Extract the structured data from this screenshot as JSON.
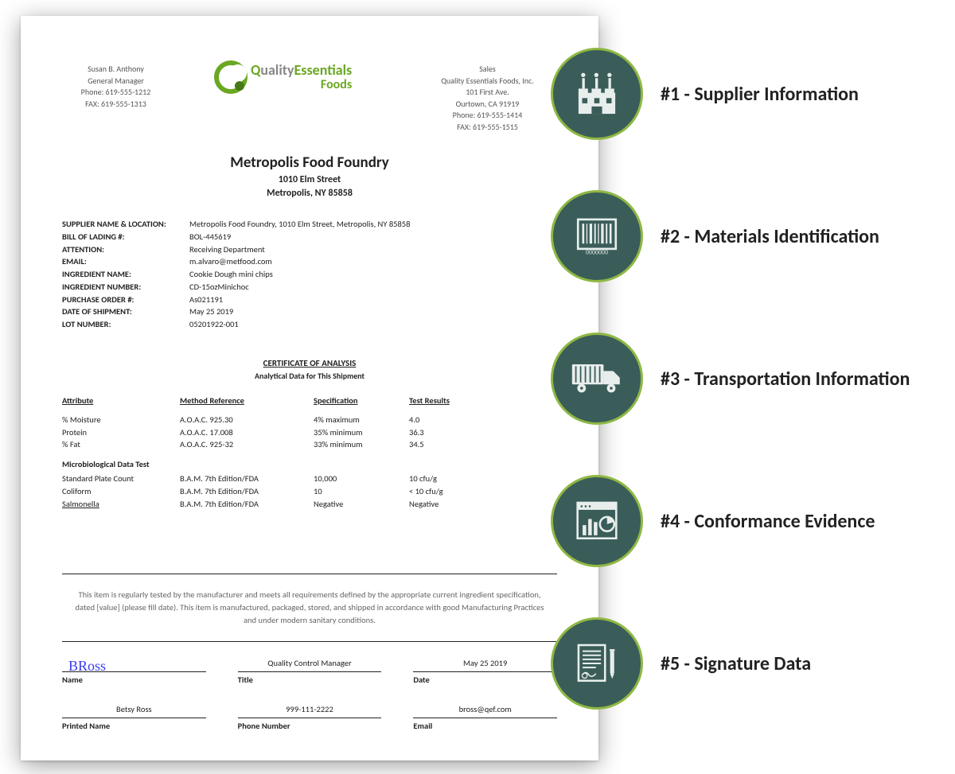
{
  "header": {
    "left": {
      "name": "Susan B. Anthony",
      "role": "General Manager",
      "phone": "Phone: 619-555-1212",
      "fax": "FAX: 619-555-1313"
    },
    "right": {
      "dept": "Sales",
      "company": "Quality Essentials Foods, Inc.",
      "addr": "101 First Ave.",
      "city": "Ourtown, CA 91919",
      "phone": "Phone: 619-555-1414",
      "fax": "FAX: 619-555-1515"
    },
    "logo": {
      "word1a": "uality",
      "word1b": "Essentials",
      "word2": "Foods"
    }
  },
  "addressee": {
    "name": "Metropolis Food Foundry",
    "line1": "1010 Elm Street",
    "line2": "Metropolis, NY 85858"
  },
  "meta": [
    {
      "k": "SUPPLIER NAME & LOCATION:",
      "v": "Metropolis Food Foundry, 1010 Elm Street, Metropolis, NY 85858"
    },
    {
      "k": "BILL OF LADING #:",
      "v": "BOL-445619"
    },
    {
      "k": "ATTENTION:",
      "v": "Receiving Department"
    },
    {
      "k": "EMAIL:",
      "v": "m.alvaro@metfood.com"
    },
    {
      "k": "INGREDIENT NAME:",
      "v": "Cookie Dough mini chips"
    },
    {
      "k": "INGREDIENT NUMBER:",
      "v": "CD-15ozMinichoc"
    },
    {
      "k": "PURCHASE ORDER #:",
      "v": "As021191"
    },
    {
      "k": "DATE OF SHIPMENT:",
      "v": "May 25 2019"
    },
    {
      "k": "LOT NUMBER:",
      "v": "05201922-001"
    }
  ],
  "cert": {
    "title": "CERTIFICATE OF ANALYSIS",
    "subtitle": "Analytical Data for This Shipment"
  },
  "table": {
    "headers": {
      "attr": "Attribute",
      "method": "Method Reference",
      "spec": "Specification",
      "result": "Test Results"
    },
    "rows": [
      {
        "attr": "% Moisture",
        "method": "A.O.A.C. 925.30",
        "spec": "4% maximum",
        "result": "4.0"
      },
      {
        "attr": "Protein",
        "method": "A.O.A.C. 17.008",
        "spec": "35% minimum",
        "result": "36.3"
      },
      {
        "attr": "% Fat",
        "method": "A.O.A.C. 925-32",
        "spec": "33% minimum",
        "result": "34.5"
      }
    ],
    "micro_header": "Microbiological Data Test",
    "micro": [
      {
        "attr": "Standard Plate Count",
        "method": "B.A.M. 7th Edition/FDA",
        "spec": "10,000",
        "result": "10 cfu/g"
      },
      {
        "attr": "Coliform",
        "method": "B.A.M. 7th Edition/FDA",
        "spec": "10",
        "result": "< 10 cfu/g"
      },
      {
        "attr": "Salmonella",
        "method": "B.A.M. 7th Edition/FDA",
        "spec": "Negative",
        "result": "Negative",
        "u": true
      }
    ]
  },
  "disclaimer": "This item is regularly tested by the manufacturer and meets all requirements defined by the appropriate current ingredient specification, dated [value] (please fill date). This item is manufactured, packaged, stored, and shipped in accordance with good Manufacturing Practices and under modern sanitary conditions.",
  "sig": {
    "row1": [
      {
        "val": "BRoss",
        "lbl": "Name",
        "script": true
      },
      {
        "val": "Quality Control Manager",
        "lbl": "Title"
      },
      {
        "val": "May 25 2019",
        "lbl": "Date"
      }
    ],
    "row2": [
      {
        "val": "Betsy Ross",
        "lbl": "Printed Name"
      },
      {
        "val": "999-111-2222",
        "lbl": "Phone Number"
      },
      {
        "val": "bross@qef.com",
        "lbl": "Email"
      }
    ]
  },
  "callouts": [
    {
      "icon": "factory",
      "text": "#1 - Supplier Information"
    },
    {
      "icon": "barcode",
      "text": "#2 - Materials Identification"
    },
    {
      "icon": "truck",
      "text": "#3 - Transportation Information"
    },
    {
      "icon": "chart",
      "text": "#4 - Conformance Evidence"
    },
    {
      "icon": "signature",
      "text": "#5 - Signature Data"
    }
  ]
}
